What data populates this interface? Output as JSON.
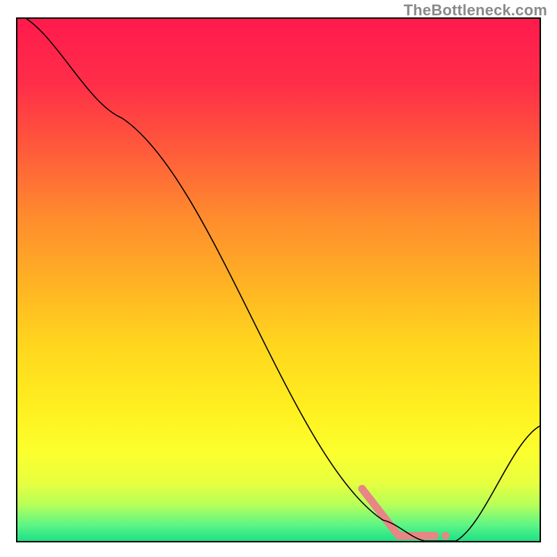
{
  "attribution": "TheBottleneck.com",
  "chart_data": {
    "type": "line",
    "title": "",
    "xlabel": "",
    "ylabel": "",
    "xlim": [
      0,
      100
    ],
    "ylim": [
      0,
      100
    ],
    "curve": [
      {
        "x": 0,
        "y": 101
      },
      {
        "x": 20,
        "y": 81
      },
      {
        "x": 70,
        "y": 4
      },
      {
        "x": 78,
        "y": 0
      },
      {
        "x": 84,
        "y": 0
      },
      {
        "x": 100,
        "y": 22
      }
    ],
    "gradient_stops": [
      {
        "offset": 0.0,
        "color": "#ff1a4d"
      },
      {
        "offset": 0.125,
        "color": "#ff2e48"
      },
      {
        "offset": 0.25,
        "color": "#ff5a3b"
      },
      {
        "offset": 0.375,
        "color": "#ff8a2e"
      },
      {
        "offset": 0.5,
        "color": "#ffb024"
      },
      {
        "offset": 0.625,
        "color": "#ffd61e"
      },
      {
        "offset": 0.75,
        "color": "#fff020"
      },
      {
        "offset": 0.83,
        "color": "#fcff2e"
      },
      {
        "offset": 0.89,
        "color": "#e6ff40"
      },
      {
        "offset": 0.93,
        "color": "#b8ff58"
      },
      {
        "offset": 0.97,
        "color": "#5cf586"
      },
      {
        "offset": 1.0,
        "color": "#1ce086"
      }
    ],
    "pink_marks": [
      {
        "x1": 66,
        "y1": 10,
        "x2": 73,
        "y2": 1
      },
      {
        "x1": 73,
        "y1": 1,
        "x2": 80,
        "y2": 1
      }
    ],
    "pink_dot": {
      "x": 82,
      "y": 1
    }
  }
}
